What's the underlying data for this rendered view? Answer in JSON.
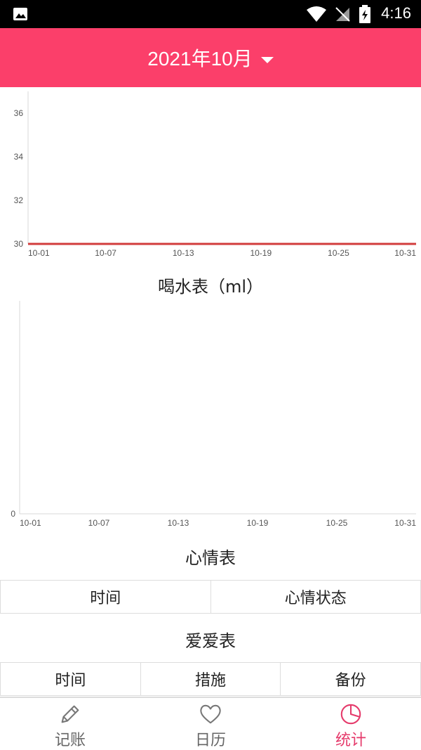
{
  "status_bar": {
    "time": "4:16"
  },
  "header": {
    "month_label": "2021年10月"
  },
  "chart_data": [
    {
      "type": "line",
      "title": "",
      "x": [
        "10-01",
        "10-07",
        "10-13",
        "10-19",
        "10-25",
        "10-31"
      ],
      "y_ticks": [
        "36",
        "34",
        "32",
        "30"
      ],
      "ylim": [
        30,
        37
      ],
      "series": [
        {
          "values": [
            30,
            30,
            30,
            30,
            30,
            30
          ],
          "color": "#d23c3c"
        }
      ]
    },
    {
      "type": "line",
      "title": "喝水表（ml）",
      "x": [
        "10-01",
        "10-07",
        "10-13",
        "10-19",
        "10-25",
        "10-31"
      ],
      "y_ticks": [
        "0"
      ],
      "ylim": [
        0,
        1
      ],
      "series": []
    }
  ],
  "mood": {
    "title": "心情表",
    "columns": [
      "时间",
      "心情状态"
    ]
  },
  "love": {
    "title": "爱爱表",
    "columns": [
      "时间",
      "措施",
      "备份"
    ]
  },
  "nav": {
    "items": [
      {
        "label": "记账",
        "icon": "pencil-icon",
        "active": false
      },
      {
        "label": "日历",
        "icon": "heart-icon",
        "active": false
      },
      {
        "label": "统计",
        "icon": "pie-chart-icon",
        "active": true
      }
    ]
  },
  "colors": {
    "accent": "#fb3f6a",
    "nav_active": "#e53a6b",
    "line": "#d23c3c"
  }
}
